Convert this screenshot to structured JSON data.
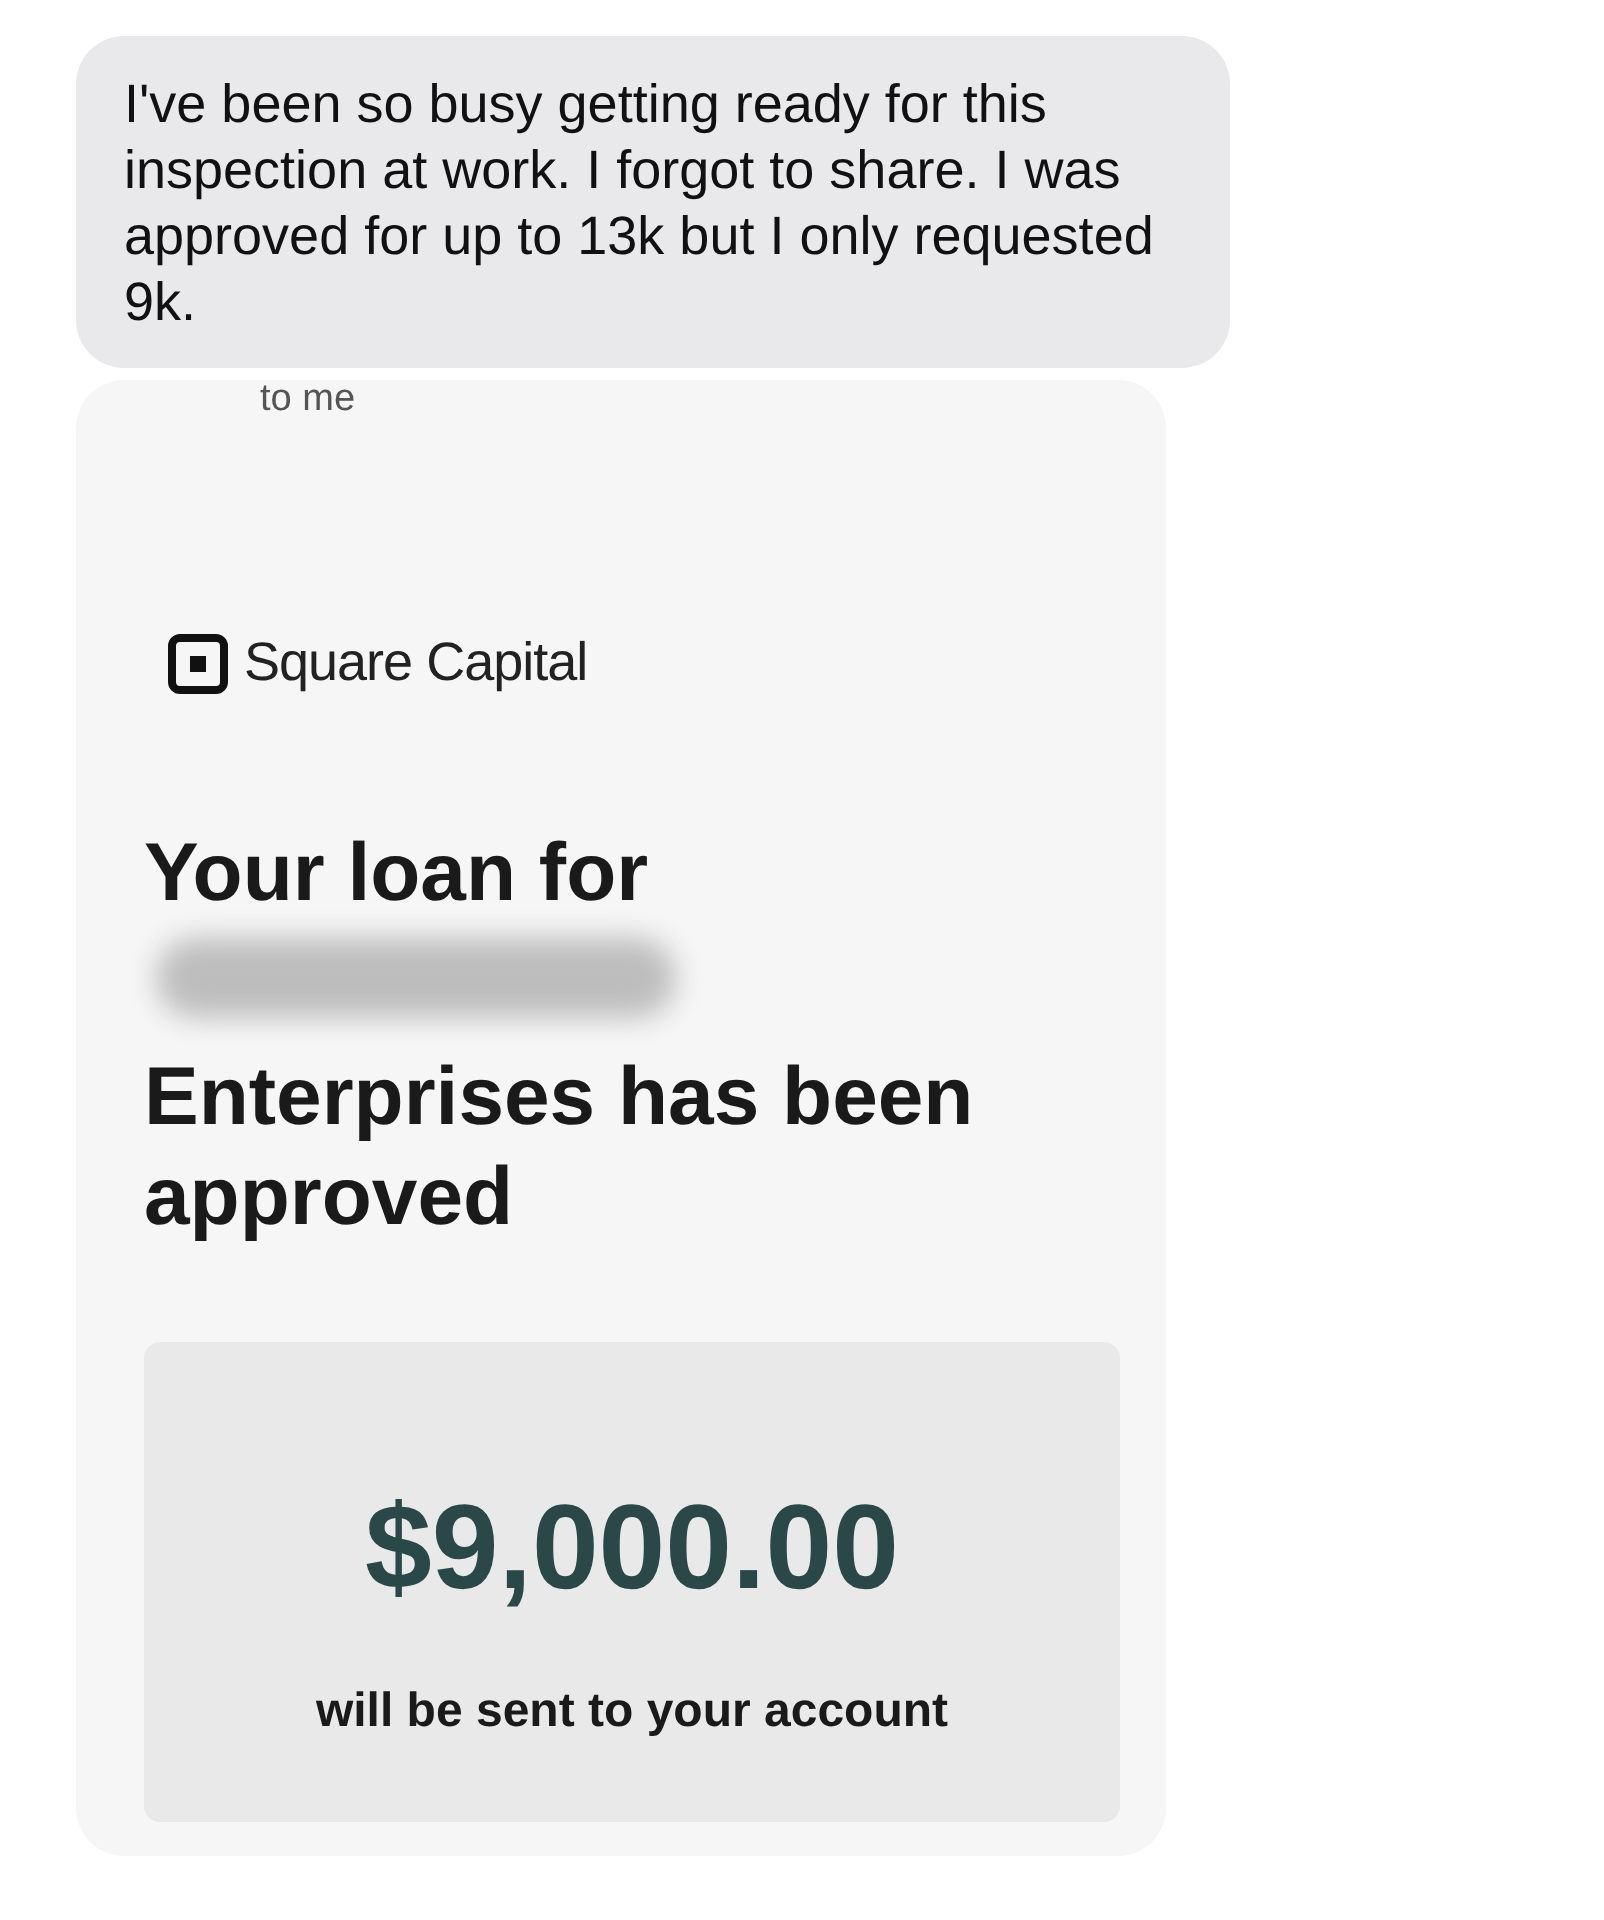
{
  "message": {
    "text": "I've been so busy getting ready for this inspection at work. I forgot to share.  I was approved for up to 13k but I only requested 9k."
  },
  "attachment": {
    "recipient": "to me",
    "brand": "Square Capital",
    "heading_start": "Your loan for",
    "redacted": true,
    "heading_end": "Enterprises has been approved",
    "amount": "$9,000.00",
    "amount_note": "will be sent to your account"
  }
}
